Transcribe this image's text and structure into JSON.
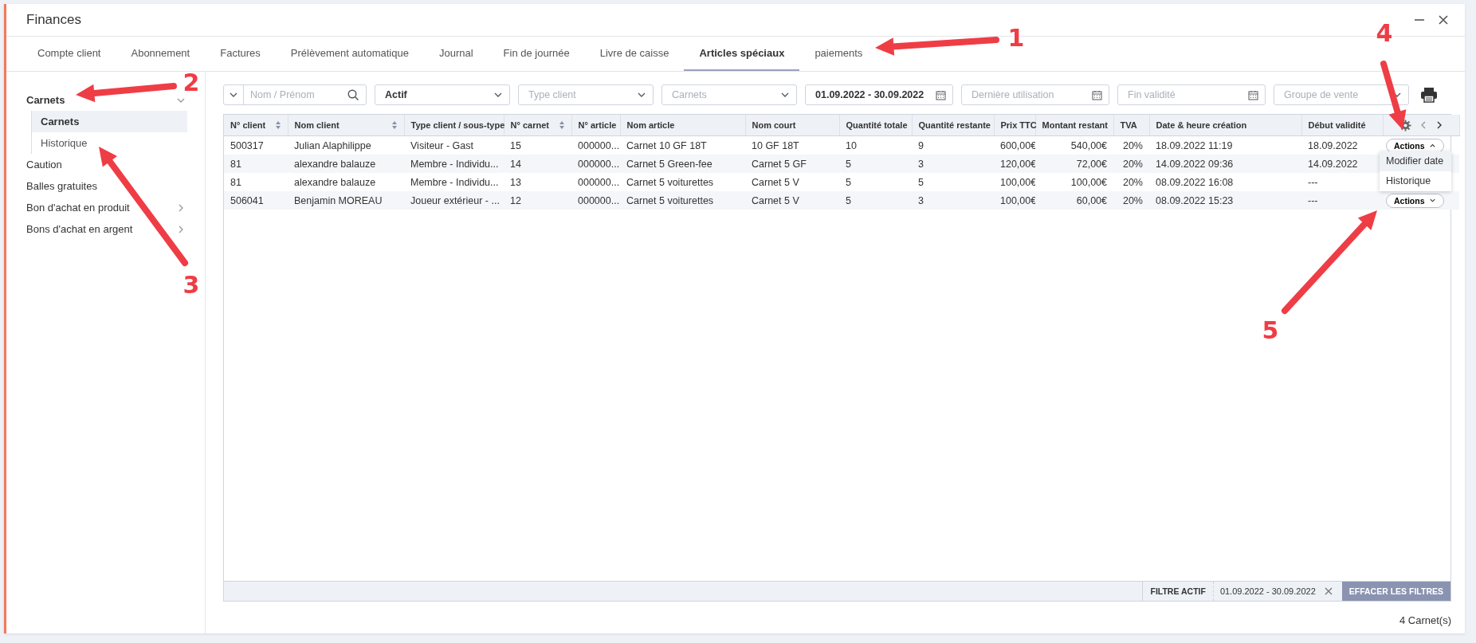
{
  "window": {
    "title": "Finances"
  },
  "tabs": [
    {
      "label": "Compte client",
      "selected": false
    },
    {
      "label": "Abonnement",
      "selected": false
    },
    {
      "label": "Factures",
      "selected": false
    },
    {
      "label": "Prélèvement automatique",
      "selected": false
    },
    {
      "label": "Journal",
      "selected": false
    },
    {
      "label": "Fin de journée",
      "selected": false
    },
    {
      "label": "Livre de caisse",
      "selected": false
    },
    {
      "label": "Articles spéciaux",
      "selected": true
    },
    {
      "label": "paiements",
      "selected": false
    }
  ],
  "sidebar": {
    "items": [
      {
        "label": "Carnets",
        "kind": "group",
        "expanded": true,
        "children": [
          {
            "label": "Carnets",
            "selected": true
          },
          {
            "label": "Historique",
            "selected": false
          }
        ]
      },
      {
        "label": "Caution",
        "kind": "leaf"
      },
      {
        "label": "Balles gratuites",
        "kind": "leaf"
      },
      {
        "label": "Bon d'achat en produit",
        "kind": "group",
        "expanded": false
      },
      {
        "label": "Bons d'achat en argent",
        "kind": "group",
        "expanded": false
      }
    ]
  },
  "filters": [
    {
      "kind": "search",
      "placeholder": "Nom / Prénom"
    },
    {
      "kind": "select",
      "value": "Actif"
    },
    {
      "kind": "select",
      "placeholder": "Type client"
    },
    {
      "kind": "select",
      "placeholder": "Carnets"
    },
    {
      "kind": "date",
      "value": "01.09.2022 - 30.09.2022"
    },
    {
      "kind": "date",
      "placeholder": "Dernière utilisation"
    },
    {
      "kind": "date",
      "placeholder": "Fin validité"
    },
    {
      "kind": "select",
      "placeholder": "Groupe de vente"
    }
  ],
  "table": {
    "columns": [
      {
        "label": "N° client",
        "sortable": true
      },
      {
        "label": "Nom client",
        "sortable": true
      },
      {
        "label": "Type client / sous-type"
      },
      {
        "label": "N° carnet",
        "sortable": true
      },
      {
        "label": "N° article"
      },
      {
        "label": "Nom article"
      },
      {
        "label": "Nom court"
      },
      {
        "label": "Quantité totale"
      },
      {
        "label": "Quantité restante"
      },
      {
        "label": "Prix TTC"
      },
      {
        "label": "Montant restant"
      },
      {
        "label": "TVA"
      },
      {
        "label": "Date & heure création"
      },
      {
        "label": "Début validité"
      }
    ],
    "rows": [
      {
        "cells": [
          "500317",
          "Julian Alaphilippe",
          "Visiteur - Gast",
          "15",
          "000000...",
          "Carnet 10 GF 18T",
          "10 GF 18T",
          "10",
          "9",
          "600,00€",
          "540,00€",
          "20%",
          "18.09.2022 11:19",
          "18.09.2022"
        ],
        "actions": {
          "label": "Actions",
          "expanded": true
        }
      },
      {
        "cells": [
          "81",
          "alexandre balauze",
          "Membre - Individu...",
          "14",
          "000000...",
          "Carnet 5 Green-fee",
          "Carnet 5 GF",
          "5",
          "3",
          "120,00€",
          "72,00€",
          "20%",
          "14.09.2022 09:36",
          "14.09.2022"
        ]
      },
      {
        "cells": [
          "81",
          "alexandre balauze",
          "Membre - Individu...",
          "13",
          "000000...",
          "Carnet 5 voiturettes",
          "Carnet 5 V",
          "5",
          "5",
          "100,00€",
          "100,00€",
          "20%",
          "08.09.2022 16:08",
          "---"
        ]
      },
      {
        "cells": [
          "506041",
          "Benjamin MOREAU",
          "Joueur extérieur - ...",
          "12",
          "000000...",
          "Carnet 5 voiturettes",
          "Carnet 5 V",
          "5",
          "3",
          "100,00€",
          "60,00€",
          "20%",
          "08.09.2022 15:23",
          "---"
        ],
        "actions": {
          "label": "Actions",
          "expanded": false
        }
      }
    ]
  },
  "actions_menu": {
    "items": [
      "Modifier date",
      "Historique"
    ]
  },
  "filter_bar": {
    "label": "FILTRE ACTIF",
    "chips": [
      "01.09.2022 - 30.09.2022"
    ],
    "clear_button": "EFFACER LES FILTRES"
  },
  "count": "4 Carnet(s)",
  "annotations": [
    {
      "label": "1"
    },
    {
      "label": "2"
    },
    {
      "label": "3"
    },
    {
      "label": "4"
    },
    {
      "label": "5"
    }
  ]
}
